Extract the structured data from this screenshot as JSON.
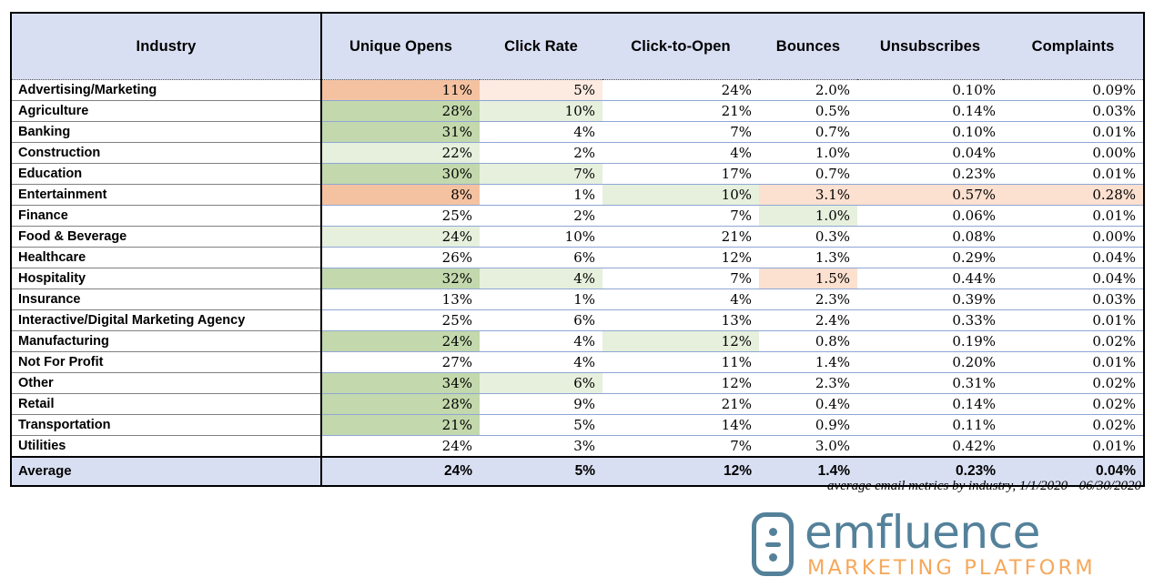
{
  "table": {
    "columns": [
      {
        "key": "industry",
        "label": "Industry"
      },
      {
        "key": "unique_opens",
        "label": "Unique Opens"
      },
      {
        "key": "click_rate",
        "label": "Click Rate"
      },
      {
        "key": "click_to_open",
        "label": "Click-to-Open"
      },
      {
        "key": "bounces",
        "label": "Bounces"
      },
      {
        "key": "unsubscribes",
        "label": "Unsubscribes"
      },
      {
        "key": "complaints",
        "label": "Complaints"
      }
    ],
    "rows": [
      {
        "industry": "Advertising/Marketing",
        "unique_opens": "11%",
        "click_rate": "5%",
        "click_to_open": "24%",
        "bounces": "2.0%",
        "unsubscribes": "0.10%",
        "complaints": "0.09%",
        "fills": {
          "unique_opens": "o1",
          "click_rate": "o4",
          "click_to_open": "",
          "bounces": "",
          "unsubscribes": "",
          "complaints": ""
        }
      },
      {
        "industry": "Agriculture",
        "unique_opens": "28%",
        "click_rate": "10%",
        "click_to_open": "21%",
        "bounces": "0.5%",
        "unsubscribes": "0.14%",
        "complaints": "0.03%",
        "fills": {
          "unique_opens": "g1",
          "click_rate": "g4",
          "click_to_open": "",
          "bounces": "",
          "unsubscribes": "",
          "complaints": ""
        }
      },
      {
        "industry": "Banking",
        "unique_opens": "31%",
        "click_rate": "4%",
        "click_to_open": "7%",
        "bounces": "0.7%",
        "unsubscribes": "0.10%",
        "complaints": "0.01%",
        "fills": {
          "unique_opens": "g1",
          "click_rate": "",
          "click_to_open": "",
          "bounces": "",
          "unsubscribes": "",
          "complaints": ""
        }
      },
      {
        "industry": "Construction",
        "unique_opens": "22%",
        "click_rate": "2%",
        "click_to_open": "4%",
        "bounces": "1.0%",
        "unsubscribes": "0.04%",
        "complaints": "0.00%",
        "fills": {
          "unique_opens": "g4",
          "click_rate": "",
          "click_to_open": "",
          "bounces": "",
          "unsubscribes": "",
          "complaints": ""
        }
      },
      {
        "industry": "Education",
        "unique_opens": "30%",
        "click_rate": "7%",
        "click_to_open": "17%",
        "bounces": "0.7%",
        "unsubscribes": "0.23%",
        "complaints": "0.01%",
        "fills": {
          "unique_opens": "g1",
          "click_rate": "g4",
          "click_to_open": "",
          "bounces": "",
          "unsubscribes": "",
          "complaints": ""
        }
      },
      {
        "industry": "Entertainment",
        "unique_opens": "8%",
        "click_rate": "1%",
        "click_to_open": "10%",
        "bounces": "3.1%",
        "unsubscribes": "0.57%",
        "complaints": "0.28%",
        "fills": {
          "unique_opens": "o1",
          "click_rate": "",
          "click_to_open": "g4",
          "bounces": "o3",
          "unsubscribes": "o3",
          "complaints": "o3"
        }
      },
      {
        "industry": "Finance",
        "unique_opens": "25%",
        "click_rate": "2%",
        "click_to_open": "7%",
        "bounces": "1.0%",
        "unsubscribes": "0.06%",
        "complaints": "0.01%",
        "fills": {
          "unique_opens": "",
          "click_rate": "",
          "click_to_open": "",
          "bounces": "g4",
          "unsubscribes": "",
          "complaints": ""
        }
      },
      {
        "industry": "Food & Beverage",
        "unique_opens": "24%",
        "click_rate": "10%",
        "click_to_open": "21%",
        "bounces": "0.3%",
        "unsubscribes": "0.08%",
        "complaints": "0.00%",
        "fills": {
          "unique_opens": "g4",
          "click_rate": "",
          "click_to_open": "",
          "bounces": "",
          "unsubscribes": "",
          "complaints": ""
        }
      },
      {
        "industry": "Healthcare",
        "unique_opens": "26%",
        "click_rate": "6%",
        "click_to_open": "12%",
        "bounces": "1.3%",
        "unsubscribes": "0.29%",
        "complaints": "0.04%",
        "fills": {
          "unique_opens": "",
          "click_rate": "",
          "click_to_open": "",
          "bounces": "",
          "unsubscribes": "",
          "complaints": ""
        }
      },
      {
        "industry": "Hospitality",
        "unique_opens": "32%",
        "click_rate": "4%",
        "click_to_open": "7%",
        "bounces": "1.5%",
        "unsubscribes": "0.44%",
        "complaints": "0.04%",
        "fills": {
          "unique_opens": "g1",
          "click_rate": "g4",
          "click_to_open": "",
          "bounces": "o3",
          "unsubscribes": "",
          "complaints": ""
        }
      },
      {
        "industry": "Insurance",
        "unique_opens": "13%",
        "click_rate": "1%",
        "click_to_open": "4%",
        "bounces": "2.3%",
        "unsubscribes": "0.39%",
        "complaints": "0.03%",
        "fills": {
          "unique_opens": "",
          "click_rate": "",
          "click_to_open": "",
          "bounces": "",
          "unsubscribes": "",
          "complaints": ""
        }
      },
      {
        "industry": "Interactive/Digital Marketing Agency",
        "unique_opens": "25%",
        "click_rate": "6%",
        "click_to_open": "13%",
        "bounces": "2.4%",
        "unsubscribes": "0.33%",
        "complaints": "0.01%",
        "fills": {
          "unique_opens": "",
          "click_rate": "",
          "click_to_open": "",
          "bounces": "",
          "unsubscribes": "",
          "complaints": ""
        }
      },
      {
        "industry": "Manufacturing",
        "unique_opens": "24%",
        "click_rate": "4%",
        "click_to_open": "12%",
        "bounces": "0.8%",
        "unsubscribes": "0.19%",
        "complaints": "0.02%",
        "fills": {
          "unique_opens": "g1",
          "click_rate": "",
          "click_to_open": "g4",
          "bounces": "",
          "unsubscribes": "",
          "complaints": ""
        }
      },
      {
        "industry": "Not For Profit",
        "unique_opens": "27%",
        "click_rate": "4%",
        "click_to_open": "11%",
        "bounces": "1.4%",
        "unsubscribes": "0.20%",
        "complaints": "0.01%",
        "fills": {
          "unique_opens": "",
          "click_rate": "",
          "click_to_open": "",
          "bounces": "",
          "unsubscribes": "",
          "complaints": ""
        }
      },
      {
        "industry": "Other",
        "unique_opens": "34%",
        "click_rate": "6%",
        "click_to_open": "12%",
        "bounces": "2.3%",
        "unsubscribes": "0.31%",
        "complaints": "0.02%",
        "fills": {
          "unique_opens": "g1",
          "click_rate": "g4",
          "click_to_open": "",
          "bounces": "",
          "unsubscribes": "",
          "complaints": ""
        }
      },
      {
        "industry": "Retail",
        "unique_opens": "28%",
        "click_rate": "9%",
        "click_to_open": "21%",
        "bounces": "0.4%",
        "unsubscribes": "0.14%",
        "complaints": "0.02%",
        "fills": {
          "unique_opens": "g1",
          "click_rate": "",
          "click_to_open": "",
          "bounces": "",
          "unsubscribes": "",
          "complaints": ""
        }
      },
      {
        "industry": "Transportation",
        "unique_opens": "21%",
        "click_rate": "5%",
        "click_to_open": "14%",
        "bounces": "0.9%",
        "unsubscribes": "0.11%",
        "complaints": "0.02%",
        "fills": {
          "unique_opens": "g1",
          "click_rate": "",
          "click_to_open": "",
          "bounces": "",
          "unsubscribes": "",
          "complaints": ""
        }
      },
      {
        "industry": "Utilities",
        "unique_opens": "24%",
        "click_rate": "3%",
        "click_to_open": "7%",
        "bounces": "3.0%",
        "unsubscribes": "0.42%",
        "complaints": "0.01%",
        "fills": {
          "unique_opens": "",
          "click_rate": "",
          "click_to_open": "",
          "bounces": "",
          "unsubscribes": "",
          "complaints": ""
        }
      }
    ],
    "footer": {
      "industry": "Average",
      "unique_opens": "24%",
      "click_rate": "5%",
      "click_to_open": "12%",
      "bounces": "1.4%",
      "unsubscribes": "0.23%",
      "complaints": "0.04%"
    }
  },
  "caption": "average email metrics by industry, 1/1/2020 - 06/30/2020",
  "logo": {
    "word": "emfluence",
    "subtitle": "MARKETING PLATFORM",
    "word_color": "#54819a",
    "subtitle_color": "#f6a85c"
  },
  "colors": {
    "header_bg": "#d9dff2",
    "grid_line": "#8fa6d4",
    "green_strong": "#c3d8ac",
    "green_light": "#e6f0dd",
    "orange_strong": "#f4c2a1",
    "orange_light": "#fdeae0"
  }
}
